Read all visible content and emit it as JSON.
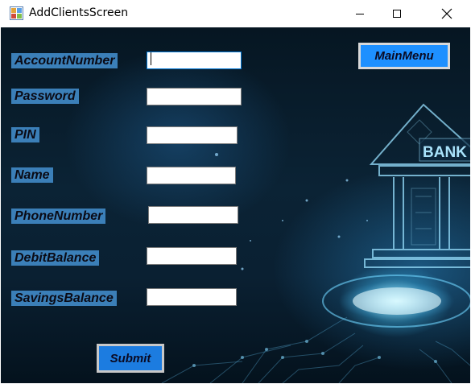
{
  "window": {
    "title": "AddClientsScreen"
  },
  "form": {
    "fields": [
      {
        "label": "AccountNumber",
        "value": ""
      },
      {
        "label": "Password",
        "value": ""
      },
      {
        "label": "PIN",
        "value": ""
      },
      {
        "label": "Name",
        "value": ""
      },
      {
        "label": "PhoneNumber",
        "value": ""
      },
      {
        "label": "DebitBalance",
        "value": ""
      },
      {
        "label": "SavingsBalance",
        "value": ""
      }
    ],
    "submit_label": "Submit"
  },
  "main_menu_label": "MainMenu",
  "background": {
    "sign_text": "BANK"
  },
  "colors": {
    "label_bg": "#3b7fb8",
    "button_bg": "#1e90ff",
    "focus_border": "#0078d7"
  },
  "icons": [
    "app-icon",
    "minimize-icon",
    "maximize-icon",
    "close-icon",
    "bank-building-icon"
  ]
}
